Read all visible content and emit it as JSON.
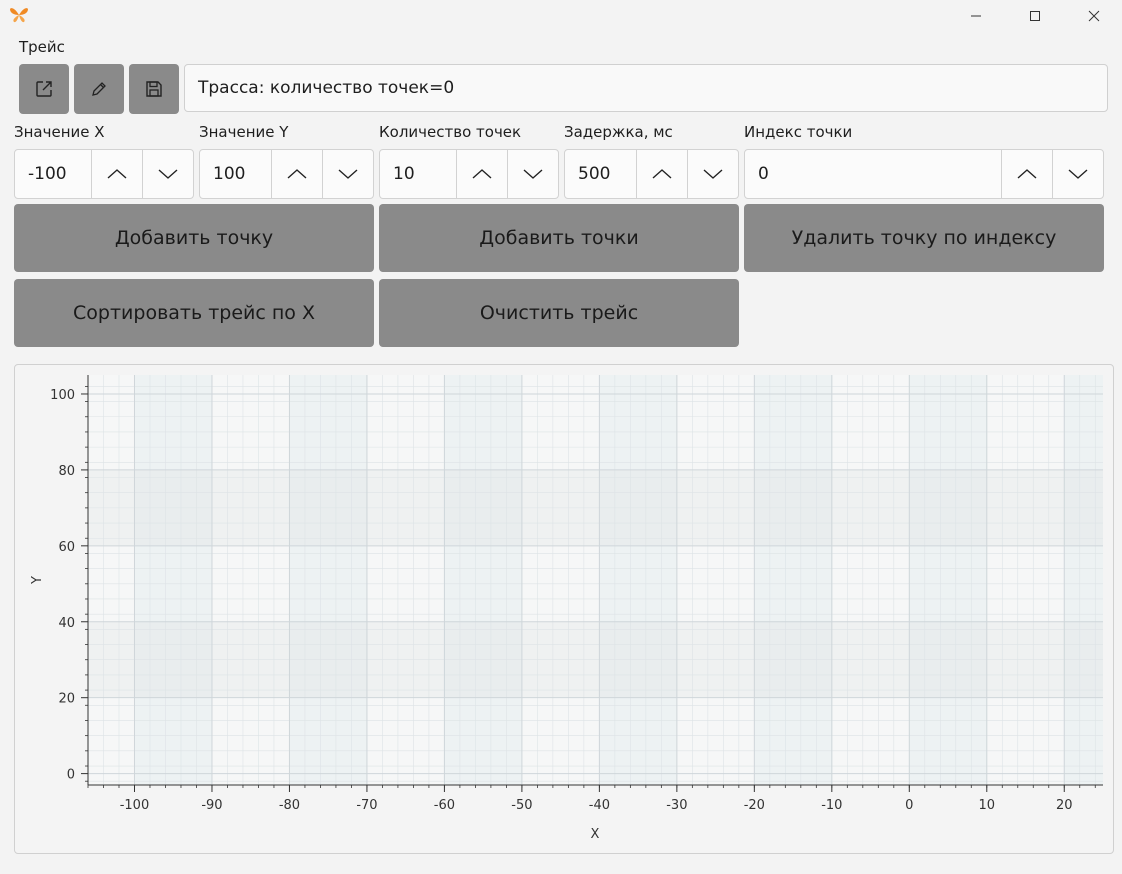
{
  "window": {
    "app_icon": "butterfly-icon",
    "controls": [
      "minimize-icon",
      "maximize-icon",
      "close-icon"
    ]
  },
  "section_label": "Трейс",
  "toolbar": {
    "icons": [
      "open-external-icon",
      "pencil-icon",
      "save-icon"
    ],
    "trace_info": "Трасса: количество точек=0"
  },
  "fields": [
    {
      "label": "Значение X",
      "value": "-100"
    },
    {
      "label": "Значение Y",
      "value": "100"
    },
    {
      "label": "Количество точек",
      "value": "10"
    },
    {
      "label": "Задержка, мс",
      "value": "500"
    },
    {
      "label": "Индекс точки",
      "value": "0"
    }
  ],
  "buttons": {
    "add_point": "Добавить точку",
    "add_points": "Добавить точки",
    "delete_by_index": "Удалить точку по индексу",
    "sort_by_x": "Сортировать трейс по X",
    "clear_trace": "Очистить трейс"
  },
  "chart_data": {
    "type": "scatter",
    "series": [],
    "xlabel": "X",
    "ylabel": "Y",
    "xlim": [
      -106,
      25
    ],
    "ylim": [
      -3,
      105
    ],
    "x_ticks": [
      "-100",
      "-90",
      "-80",
      "-70",
      "-60",
      "-50",
      "-40",
      "-30",
      "-20",
      "-10",
      "0",
      "10",
      "20"
    ],
    "y_ticks": [
      "0",
      "20",
      "40",
      "60",
      "80",
      "100"
    ],
    "grid": true
  }
}
